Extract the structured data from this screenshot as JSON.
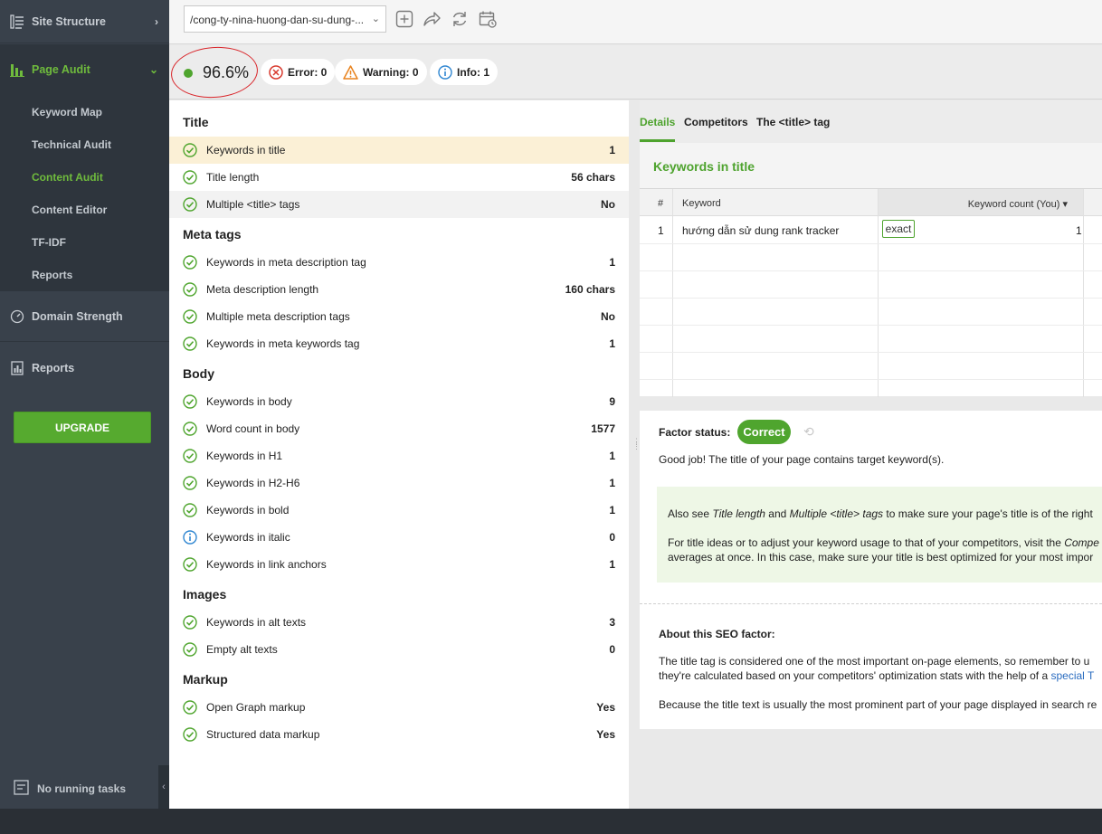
{
  "sidebar": {
    "site_structure": "Site Structure",
    "page_audit": "Page Audit",
    "sub_items": [
      "Keyword Map",
      "Technical Audit",
      "Content Audit",
      "Content Editor",
      "TF-IDF",
      "Reports"
    ],
    "active_sub": "Content Audit",
    "domain_strength": "Domain Strength",
    "reports": "Reports",
    "upgrade": "UPGRADE",
    "tasks": "No running tasks"
  },
  "toolbar": {
    "url": "/cong-ty-nina-huong-dan-su-dung-...",
    "icons": [
      "add-icon",
      "share-icon",
      "refresh-icon",
      "schedule-icon"
    ]
  },
  "scorebar": {
    "score": "96.6%",
    "error": "Error: 0",
    "warning": "Warning: 0",
    "info": "Info: 1"
  },
  "factors": {
    "sections": [
      {
        "title": "Title",
        "rows": [
          {
            "label": "Keywords in title",
            "value": "1",
            "status": "ok"
          },
          {
            "label": "Title length",
            "value": "56 chars",
            "status": "ok"
          },
          {
            "label": "Multiple <title> tags",
            "value": "No",
            "status": "ok"
          }
        ]
      },
      {
        "title": "Meta tags",
        "rows": [
          {
            "label": "Keywords in meta description tag",
            "value": "1",
            "status": "ok"
          },
          {
            "label": "Meta description length",
            "value": "160 chars",
            "status": "ok"
          },
          {
            "label": "Multiple meta description tags",
            "value": "No",
            "status": "ok"
          },
          {
            "label": "Keywords in meta keywords tag",
            "value": "1",
            "status": "ok"
          }
        ]
      },
      {
        "title": "Body",
        "rows": [
          {
            "label": "Keywords in body",
            "value": "9",
            "status": "ok"
          },
          {
            "label": "Word count in body",
            "value": "1577",
            "status": "ok"
          },
          {
            "label": "Keywords in H1",
            "value": "1",
            "status": "ok"
          },
          {
            "label": "Keywords in H2-H6",
            "value": "1",
            "status": "ok"
          },
          {
            "label": "Keywords in bold",
            "value": "1",
            "status": "ok"
          },
          {
            "label": "Keywords in italic",
            "value": "0",
            "status": "info"
          },
          {
            "label": "Keywords in link anchors",
            "value": "1",
            "status": "ok"
          }
        ]
      },
      {
        "title": "Images",
        "rows": [
          {
            "label": "Keywords in alt texts",
            "value": "3",
            "status": "ok"
          },
          {
            "label": "Empty alt texts",
            "value": "0",
            "status": "ok"
          }
        ]
      },
      {
        "title": "Markup",
        "rows": [
          {
            "label": "Open Graph markup",
            "value": "Yes",
            "status": "ok"
          },
          {
            "label": "Structured data markup",
            "value": "Yes",
            "status": "ok"
          }
        ]
      }
    ]
  },
  "detail": {
    "tabs": [
      "Details",
      "Competitors",
      "The <title> tag"
    ],
    "header": "Keywords in title",
    "columns": [
      "#",
      "Keyword",
      "Keyword count (You) ▾"
    ],
    "row": {
      "num": "1",
      "keyword": "hướng dẫn sử dung rank tracker",
      "badge": "exact",
      "count": "1"
    },
    "factor_status_label": "Factor status:",
    "factor_status": "Correct",
    "good_job": "Good job! The title of your page contains target keyword(s).",
    "note1_a": "Also see ",
    "note1_b": "Title length",
    "note1_c": " and ",
    "note1_d": "Multiple <title> tags",
    "note1_e": " to make sure your page's title is of the right",
    "note2_a": "For title ideas or to adjust your keyword usage to that of your competitors, visit the ",
    "note2_b": "Compe",
    "note3": "averages at once. In this case, make sure your title is best optimized for your most impor",
    "about_title": "About this SEO factor:",
    "about1": "The title tag is considered one of the most important on-page elements, so remember to u",
    "about2_a": "they're calculated based on your competitors' optimization stats with the help of a ",
    "about2_link": "special T",
    "about3": "Because the title text is usually the most prominent part of your page displayed in search re"
  }
}
